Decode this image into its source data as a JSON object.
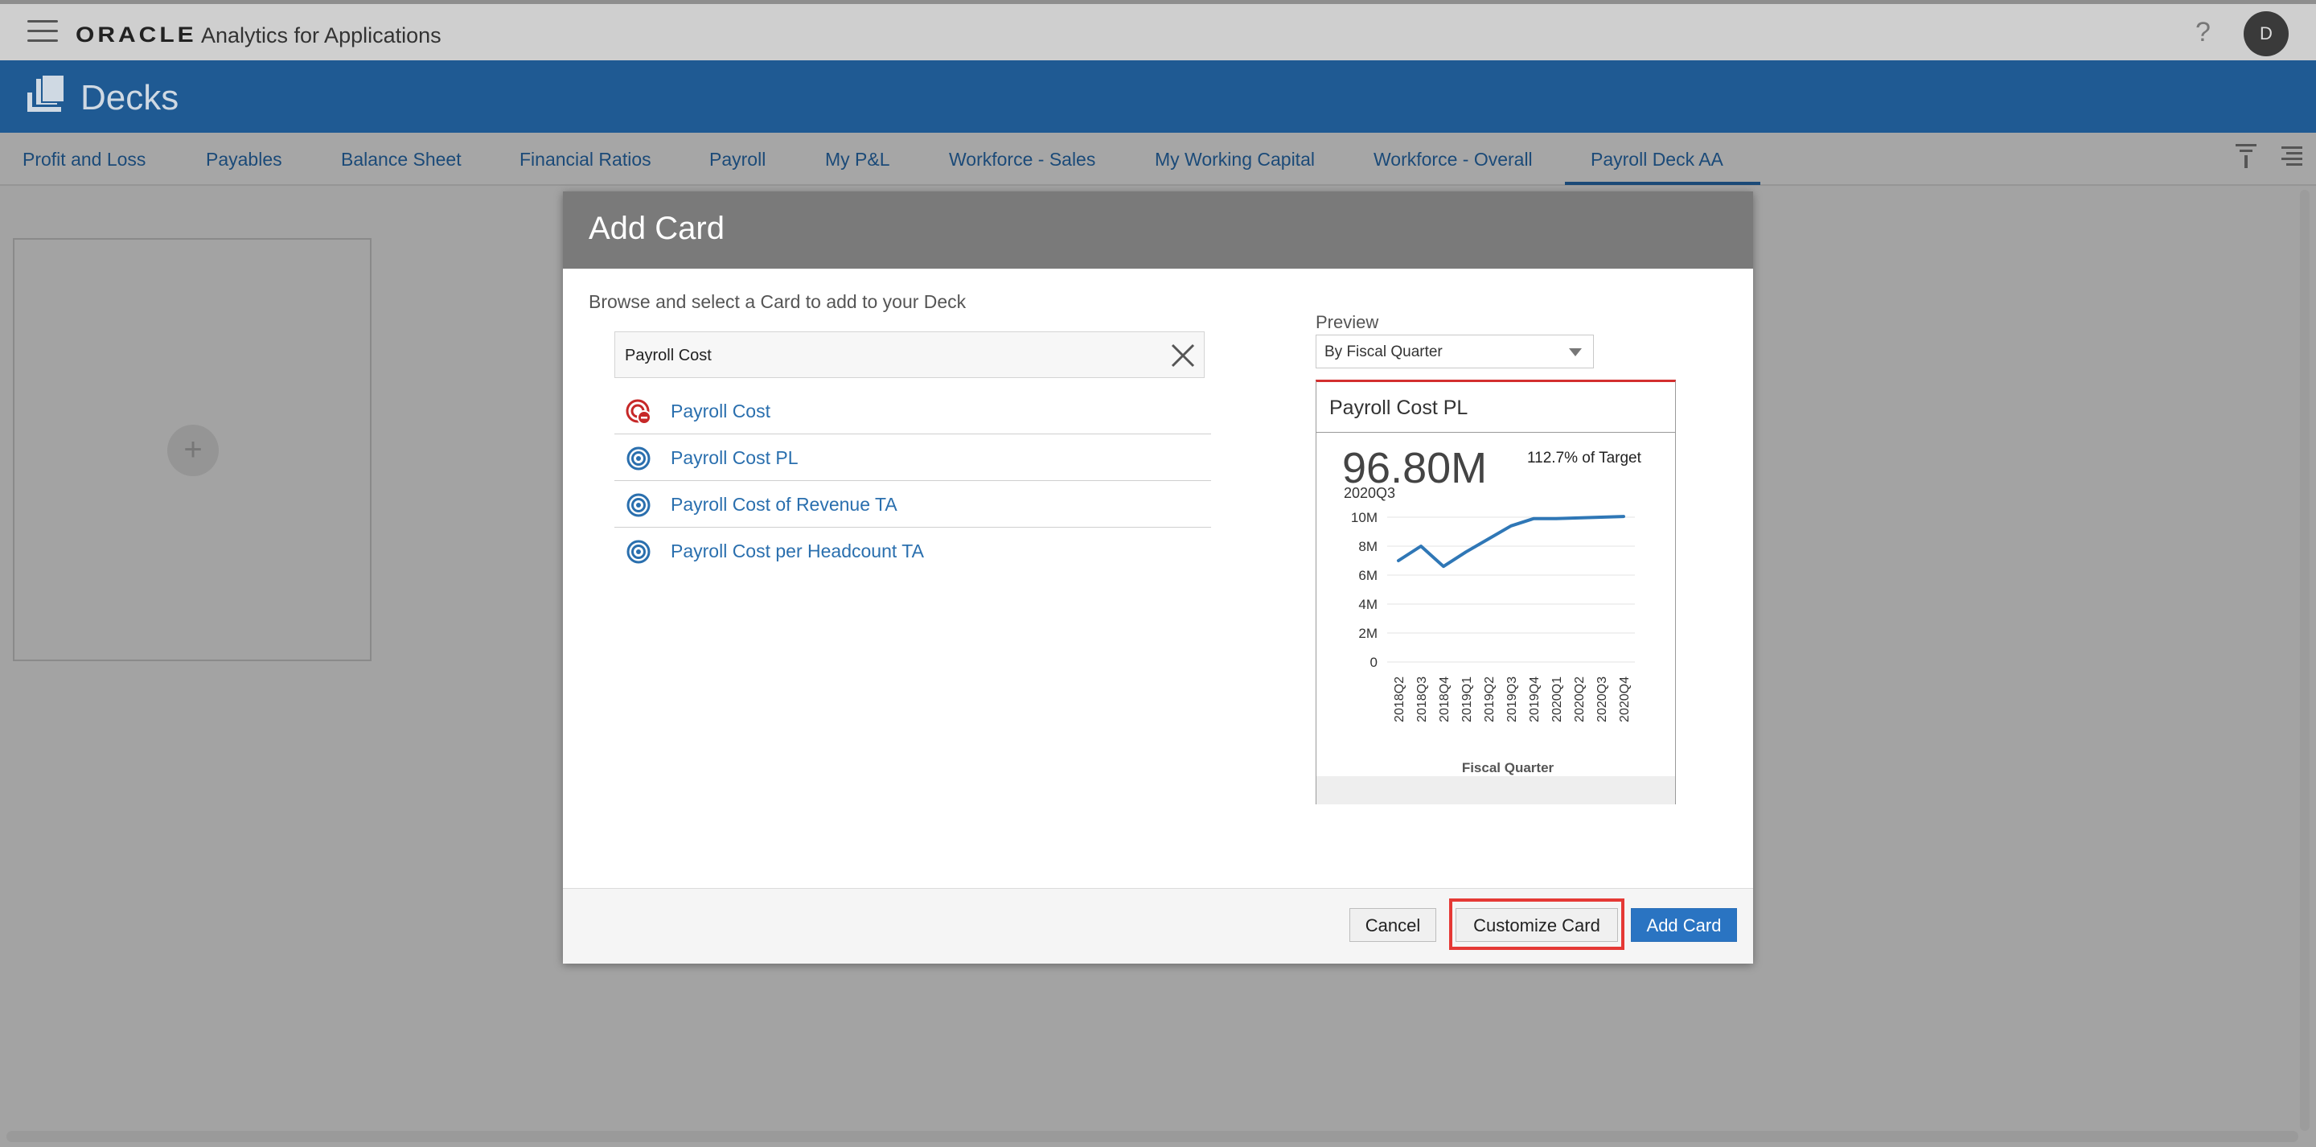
{
  "topbar": {
    "brand": "ORACLE",
    "app_title": "Analytics for Applications",
    "help": "?",
    "avatar_initial": "D"
  },
  "header": {
    "title": "Decks"
  },
  "tabs": [
    {
      "label": "Profit and Loss"
    },
    {
      "label": "Payables"
    },
    {
      "label": "Balance Sheet"
    },
    {
      "label": "Financial Ratios"
    },
    {
      "label": "Payroll"
    },
    {
      "label": "My P&L"
    },
    {
      "label": "Workforce - Sales"
    },
    {
      "label": "My Working Capital"
    },
    {
      "label": "Workforce - Overall"
    },
    {
      "label": "Payroll Deck AA",
      "active": true
    }
  ],
  "placeholder": {
    "plus": "+"
  },
  "modal": {
    "title": "Add Card",
    "instruction": "Browse and select a Card to add to your Deck",
    "search": {
      "value": "Payroll Cost"
    },
    "results": [
      {
        "label": "Payroll Cost",
        "icon": "alert-target-icon",
        "color": "#c62828"
      },
      {
        "label": "Payroll Cost PL",
        "icon": "target-icon",
        "color": "#2a6fae"
      },
      {
        "label": "Payroll Cost of Revenue TA",
        "icon": "target-icon",
        "color": "#2a6fae"
      },
      {
        "label": "Payroll Cost per Headcount TA",
        "icon": "target-icon",
        "color": "#2a6fae"
      }
    ],
    "preview": {
      "label": "Preview",
      "selected": "By Fiscal Quarter"
    },
    "card": {
      "title": "Payroll Cost PL",
      "value": "96.80M",
      "period": "2020Q3",
      "target": "112.7% of Target"
    },
    "buttons": {
      "cancel": "Cancel",
      "customize": "Customize Card",
      "add": "Add Card"
    }
  },
  "colors": {
    "brand_blue": "#1f5a93",
    "link": "#2a6fae",
    "highlight": "#e53935",
    "primary_button": "#2a74c2",
    "line": "#2f77b6"
  },
  "chart_data": {
    "type": "line",
    "x": [
      "2018Q2",
      "2018Q3",
      "2018Q4",
      "2019Q1",
      "2019Q2",
      "2019Q3",
      "2019Q4",
      "2020Q1",
      "2020Q2",
      "2020Q3",
      "2020Q4"
    ],
    "series": [
      {
        "values": [
          7.0,
          8.0,
          6.6,
          7.6,
          8.5,
          9.4,
          9.9,
          9.9,
          9.95,
          10.0,
          10.05
        ]
      }
    ],
    "y_ticks": [
      "0",
      "2M",
      "4M",
      "6M",
      "8M",
      "10M"
    ],
    "y_tick_values": [
      0,
      2,
      4,
      6,
      8,
      10
    ],
    "ylim": [
      0,
      10
    ],
    "xlabel": "Fiscal Quarter",
    "ylabel": "",
    "grid": true
  }
}
